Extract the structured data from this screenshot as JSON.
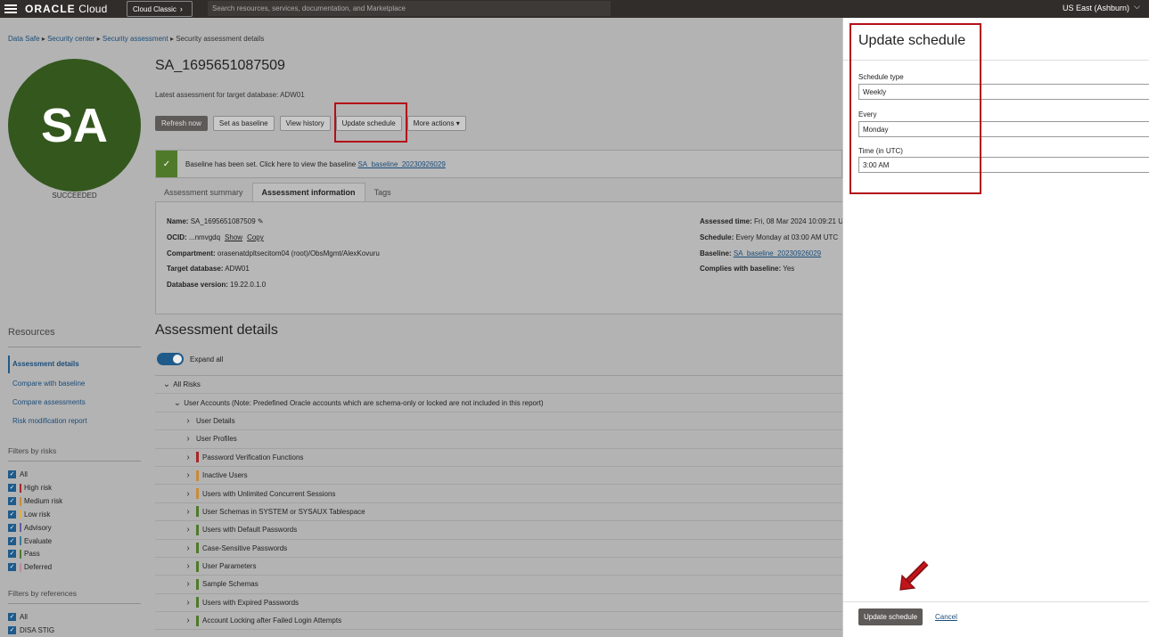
{
  "topbar": {
    "brand_bold": "ORACLE",
    "brand_light": " Cloud",
    "cloud_classic": "Cloud Classic",
    "search_placeholder": "Search resources, services, documentation, and Marketplace",
    "region": "US East (Ashburn)"
  },
  "breadcrumbs": [
    {
      "label": "Data Safe"
    },
    {
      "label": "Security center"
    },
    {
      "label": "Security assessment"
    },
    {
      "label": "Security assessment details"
    }
  ],
  "breadcrumb_sep": "▸",
  "assessment": {
    "avatar_initials": "SA",
    "status": "SUCCEEDED",
    "title": "SA_1695651087509",
    "subtitle": "Latest assessment for target database: ADW01"
  },
  "actions": {
    "refresh": "Refresh now",
    "baseline": "Set as baseline",
    "history": "View history",
    "update_schedule": "Update schedule",
    "more": "More actions",
    "more_caret": "▾"
  },
  "banner": {
    "text": "Baseline has been set. Click here to view the baseline",
    "link": "SA_baseline_20230926029"
  },
  "tabs": {
    "summary": "Assessment summary",
    "info": "Assessment information",
    "tags": "Tags"
  },
  "info": {
    "name_label": "Name:",
    "name_value": "SA_1695651087509",
    "ocid_label": "OCID:",
    "ocid_value": "...nmvgdq",
    "show": "Show",
    "copy": "Copy",
    "compartment_label": "Compartment:",
    "compartment_value": "orasenatdpltsecitom04 (root)/ObsMgmt/AlexKovuru",
    "target_label": "Target database:",
    "target_value": "ADW01",
    "dbver_label": "Database version:",
    "dbver_value": "19.22.0.1.0",
    "time_label": "Assessed time:",
    "time_value": "Fri, 08 Mar 2024 10:09:21 U",
    "schedule_label": "Schedule:",
    "schedule_value": "Every Monday at 03:00 AM UTC",
    "baseline_label": "Baseline:",
    "baseline_value": "SA_baseline_20230926029",
    "complies_label": "Complies with baseline:",
    "complies_value": "Yes"
  },
  "details": {
    "heading": "Assessment details",
    "expand_all": "Expand all",
    "all_risks": "All Risks",
    "user_accounts": "User Accounts (Note: Predefined Oracle accounts which are schema-only or locked are not included in this report)",
    "rows": [
      {
        "label": "User Details",
        "color": ""
      },
      {
        "label": "User Profiles",
        "color": ""
      },
      {
        "label": "Password Verification Functions",
        "color": "#a8252a"
      },
      {
        "label": "Inactive Users",
        "color": "#c98a3a"
      },
      {
        "label": "Users with Unlimited Concurrent Sessions",
        "color": "#c98a3a"
      },
      {
        "label": "User Schemas in SYSTEM or SYSAUX Tablespace",
        "color": "#4f7a2a"
      },
      {
        "label": "Users with Default Passwords",
        "color": "#4f7a2a"
      },
      {
        "label": "Case-Sensitive Passwords",
        "color": "#4f7a2a"
      },
      {
        "label": "User Parameters",
        "color": "#4f7a2a"
      },
      {
        "label": "Sample Schemas",
        "color": "#4f7a2a"
      },
      {
        "label": "Users with Expired Passwords",
        "color": "#4f7a2a"
      },
      {
        "label": "Account Locking after Failed Login Attempts",
        "color": "#4f7a2a"
      }
    ]
  },
  "sidebar": {
    "resources_heading": "Resources",
    "links": [
      "Assessment details",
      "Compare with baseline",
      "Compare assessments",
      "Risk modification report"
    ],
    "filters_risk_heading": "Filters by risks",
    "risk_filters": [
      {
        "label": "All",
        "color": ""
      },
      {
        "label": "High risk",
        "color": "#a8252a"
      },
      {
        "label": "Medium risk",
        "color": "#c98a3a"
      },
      {
        "label": "Low risk",
        "color": "#d8b24a"
      },
      {
        "label": "Advisory",
        "color": "#6a5a9a"
      },
      {
        "label": "Evaluate",
        "color": "#3a7a9a"
      },
      {
        "label": "Pass",
        "color": "#4f7a2a"
      },
      {
        "label": "Deferred",
        "color": "#b88aa0"
      }
    ],
    "filters_ref_heading": "Filters by references",
    "ref_filters": [
      {
        "label": "All"
      },
      {
        "label": "DISA STIG"
      }
    ]
  },
  "drawer": {
    "title": "Update schedule",
    "schedule_type_label": "Schedule type",
    "schedule_type_value": "Weekly",
    "every_label": "Every",
    "every_value": "Monday",
    "time_label": "Time (in UTC)",
    "time_value": "3:00 AM",
    "submit": "Update schedule",
    "cancel": "Cancel"
  },
  "colors": {
    "highlight": "#b40f17",
    "primary": "#5e5a57",
    "link": "#1a4d7a",
    "success": "#4f7a2a"
  }
}
